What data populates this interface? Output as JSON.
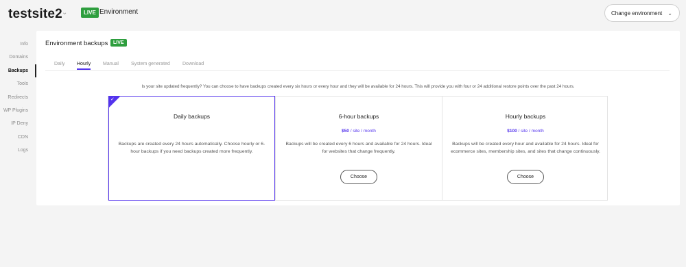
{
  "header": {
    "site_name": "testsite2",
    "env_badge": "LIVE",
    "env_label": "Environment",
    "change_env_label": "Change environment"
  },
  "sidebar": {
    "items": [
      {
        "label": "Info"
      },
      {
        "label": "Domains"
      },
      {
        "label": "Backups",
        "active": true
      },
      {
        "label": "Tools"
      },
      {
        "label": "Redirects"
      },
      {
        "label": "WP Plugins"
      },
      {
        "label": "IP Deny"
      },
      {
        "label": "CDN"
      },
      {
        "label": "Logs"
      }
    ]
  },
  "panel": {
    "title": "Environment backups",
    "badge": "LIVE",
    "tabs": [
      {
        "label": "Daily"
      },
      {
        "label": "Hourly",
        "active": true
      },
      {
        "label": "Manual"
      },
      {
        "label": "System generated"
      },
      {
        "label": "Download"
      }
    ],
    "info_text": "Is your site updated frequently? You can choose to have backups created every six hours or every hour and they will be available for 24 hours. This will provide you with four or 24 additional restore points over the past 24 hours.",
    "plans": [
      {
        "title": "Daily backups",
        "selected": true,
        "description": "Backups are created every 24 hours automatically. Choose hourly or 6-hour backups if you need backups created more frequently."
      },
      {
        "title": "6-hour backups",
        "price": "$50",
        "price_suffix": " / site / month",
        "description": "Backups will be created every 6 hours and available for 24 hours. Ideal for websites that change frequently.",
        "button": "Choose"
      },
      {
        "title": "Hourly backups",
        "price": "$100",
        "price_suffix": " / site / month",
        "description": "Backups will be created every hour and available for 24 hours. Ideal for ecommerce sites, membership sites, and sites that change continuously.",
        "button": "Choose"
      }
    ]
  },
  "colors": {
    "accent": "#5333ed",
    "live_green": "#2e9e3e"
  },
  "icons": {
    "site_caret": "chevron-down-icon",
    "change_env_caret": "chevron-down-icon",
    "selected_check": "check-icon"
  }
}
